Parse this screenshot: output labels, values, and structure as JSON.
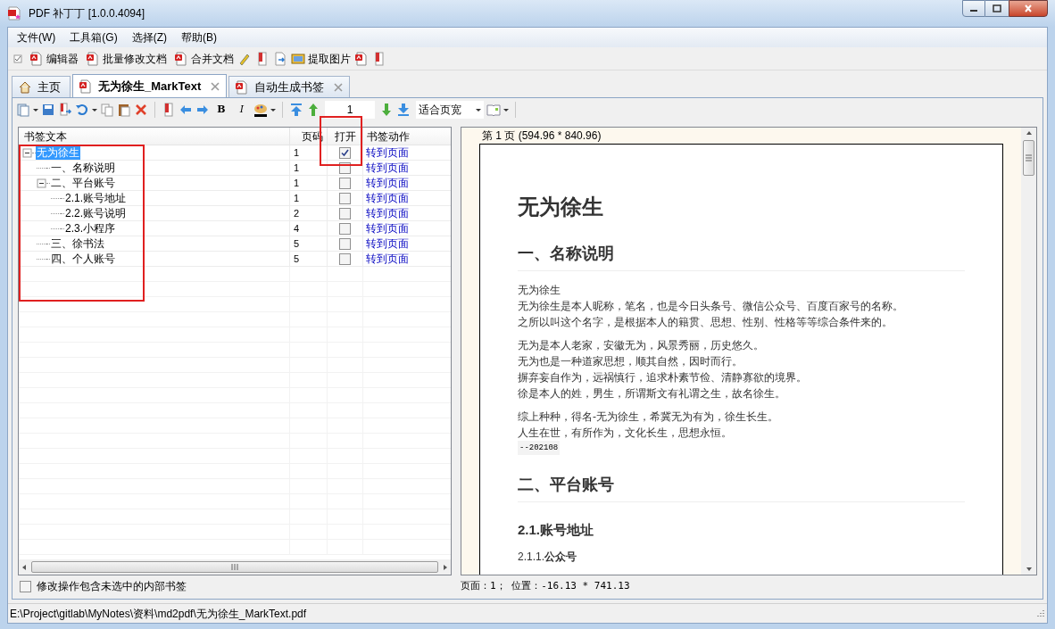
{
  "window": {
    "title": "PDF 补丁丁 [1.0.0.4094]"
  },
  "menu": [
    "文件(W)",
    "工具箱(G)",
    "选择(Z)",
    "帮助(B)"
  ],
  "toolbar": [
    {
      "label": "编辑器"
    },
    {
      "label": "批量修改文档"
    },
    {
      "label": "合并文档"
    },
    {
      "label": "提取图片"
    }
  ],
  "tabs": [
    {
      "label": "主页",
      "selected": false,
      "closable": false
    },
    {
      "label": "无为徐生_MarkText",
      "selected": true,
      "closable": true
    },
    {
      "label": "自动生成书签",
      "selected": false,
      "closable": true
    }
  ],
  "editor_toolbar": {
    "format_buttons": [
      "B",
      "I"
    ],
    "page_number": "1",
    "zoom": "适合页宽"
  },
  "bookmarks": {
    "columns": [
      "书签文本",
      "页码",
      "打开",
      "书签动作"
    ],
    "rows": [
      {
        "text": "无为徐生",
        "page": "1",
        "open": true,
        "action": "转到页面",
        "selected": true,
        "expanded": true,
        "children": [
          {
            "text": "一、名称说明",
            "page": "1",
            "open": false,
            "action": "转到页面",
            "selected": false
          },
          {
            "text": "二、平台账号",
            "page": "1",
            "open": false,
            "action": "转到页面",
            "selected": false,
            "expanded": true,
            "children": [
              {
                "text": "2.1.账号地址",
                "page": "1",
                "open": false,
                "action": "转到页面",
                "selected": false
              },
              {
                "text": "2.2.账号说明",
                "page": "2",
                "open": false,
                "action": "转到页面",
                "selected": false
              },
              {
                "text": "2.3.小程序",
                "page": "4",
                "open": false,
                "action": "转到页面",
                "selected": false
              }
            ]
          },
          {
            "text": "三、徐书法",
            "page": "5",
            "open": false,
            "action": "转到页面",
            "selected": false
          },
          {
            "text": "四、个人账号",
            "page": "5",
            "open": false,
            "action": "转到页面",
            "selected": false
          }
        ]
      }
    ]
  },
  "include_unselected": {
    "label": "修改操作包含未选中的内部书签",
    "checked": false
  },
  "viewer": {
    "page_header": "第 1 页 (594.96 * 840.96)",
    "document": [
      {
        "kind": "h1",
        "text": "无为徐生"
      },
      {
        "kind": "h2",
        "text": "一、名称说明"
      },
      {
        "kind": "p",
        "lines": [
          "无为徐生",
          "无为徐生是本人昵称，笔名，也是今日头条号、微信公众号、百度百家号的名称。",
          "之所以叫这个名字，是根据本人的籍贯、思想、性别、性格等等综合条件来的。"
        ]
      },
      {
        "kind": "p",
        "lines": [
          "无为是本人老家，安徽无为，风景秀丽，历史悠久。",
          "无为也是一种道家思想，顺其自然，因时而行。",
          "摒弃妄自作为，远祸慎行，追求朴素节俭、清静寡欲的境界。",
          "徐是本人的姓，男生，所谓斯文有礼谓之生，故名徐生。"
        ]
      },
      {
        "kind": "p",
        "lines": [
          "综上种种，得名-无为徐生，希冀无为有为，徐生长生。",
          "人生在世，有所作为，文化长生，思想永恒。"
        ]
      },
      {
        "kind": "code",
        "text": "--202108"
      },
      {
        "kind": "h2",
        "text": "二、平台账号"
      },
      {
        "kind": "h3",
        "text": "2.1.账号地址"
      },
      {
        "kind": "h4",
        "text": "2.1.1.**公众号**"
      }
    ],
    "position": "页面：1； 位置：-16.13 * 741.13"
  },
  "status_bar": "E:\\Project\\gitlab\\MyNotes\\资料\\md2pdf\\无为徐生_MarkText.pdf"
}
